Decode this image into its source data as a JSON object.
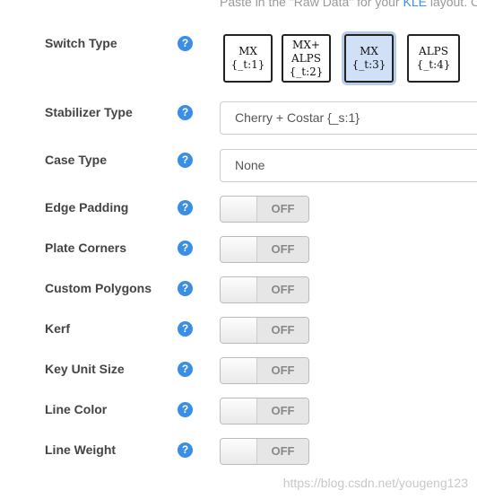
{
  "top_hint": {
    "text": "Paste in the \"Raw Data\" for your ",
    "link": "KLE",
    "suffix": " layout. C"
  },
  "help_glyph": "?",
  "switch_type": {
    "label": "Switch Type",
    "options": [
      {
        "line1": "MX",
        "line2": "{_t:1}",
        "line3": ""
      },
      {
        "line1": "MX+",
        "line2": "ALPS",
        "line3": "{_t:2}"
      },
      {
        "line1": "MX",
        "line2": "{_t:3}",
        "line3": ""
      },
      {
        "line1": "ALPS",
        "line2": "{_t:4}",
        "line3": ""
      }
    ],
    "selected_index": 2
  },
  "stabilizer_type": {
    "label": "Stabilizer Type",
    "value": "Cherry + Costar {_s:1}"
  },
  "case_type": {
    "label": "Case Type",
    "value": "None"
  },
  "toggles": [
    {
      "label": "Edge Padding",
      "state": "OFF"
    },
    {
      "label": "Plate Corners",
      "state": "OFF"
    },
    {
      "label": "Custom Polygons",
      "state": "OFF"
    },
    {
      "label": "Kerf",
      "state": "OFF"
    },
    {
      "label": "Key Unit Size",
      "state": "OFF"
    },
    {
      "label": "Line Color",
      "state": "OFF"
    },
    {
      "label": "Line Weight",
      "state": "OFF"
    }
  ],
  "watermark": "https://blog.csdn.net/yougeng123",
  "colors": {
    "accent": "#3a8ee6",
    "selected_bg": "#cfe0f7"
  }
}
